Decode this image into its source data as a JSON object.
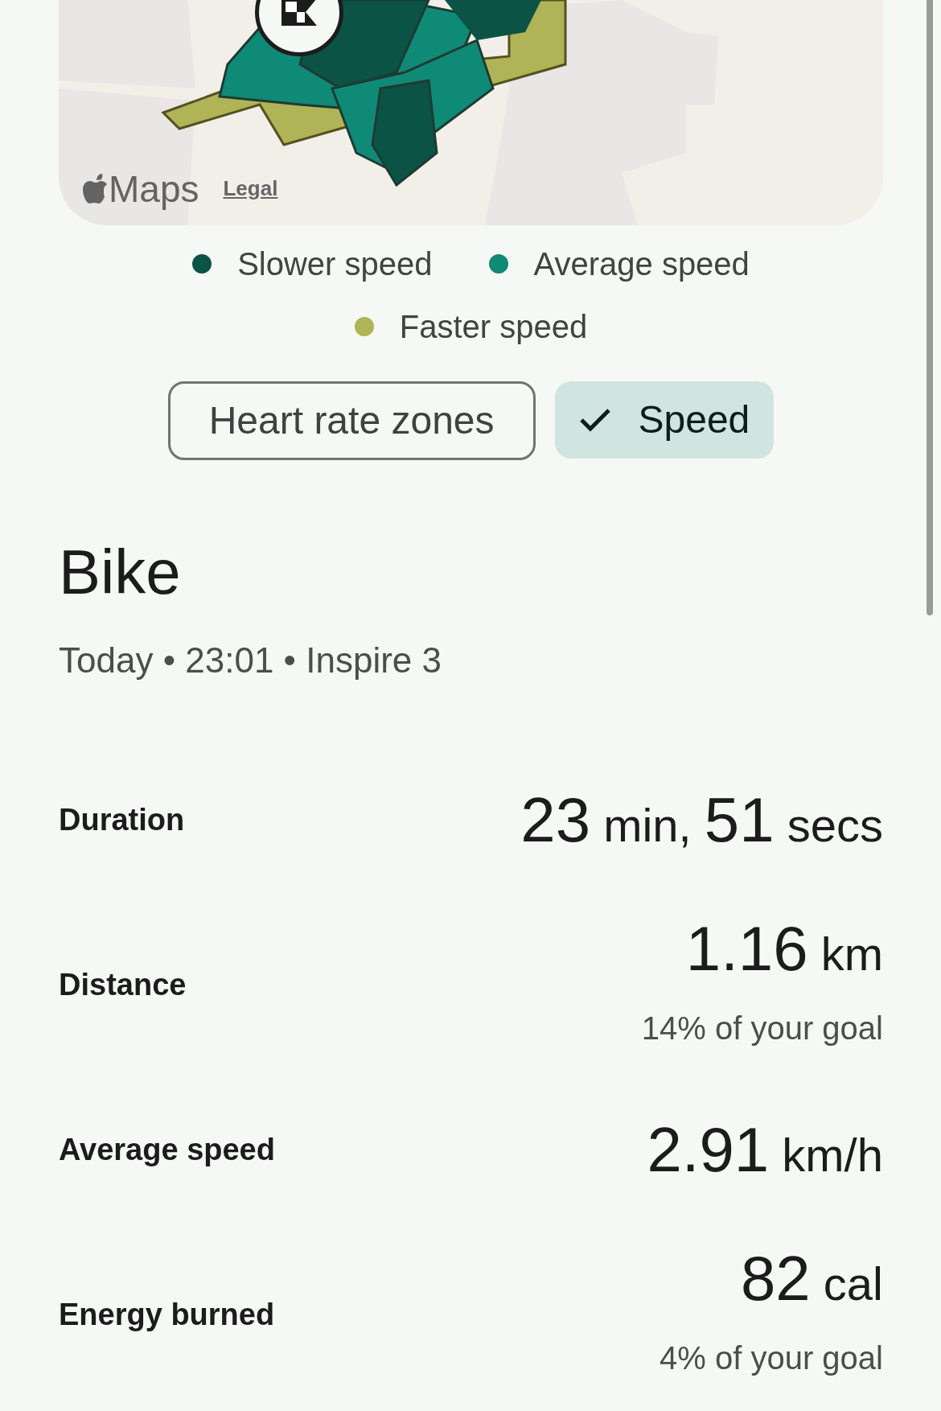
{
  "map": {
    "attribution": "Maps",
    "legal_link": "Legal"
  },
  "legend": [
    {
      "label": "Slower speed",
      "color": "#0b5345"
    },
    {
      "label": "Average speed",
      "color": "#0f8a77"
    },
    {
      "label": "Faster speed",
      "color": "#b0b456"
    }
  ],
  "chips": [
    {
      "label": "Heart rate zones",
      "selected": false
    },
    {
      "label": "Speed",
      "selected": true
    }
  ],
  "activity": {
    "title": "Bike",
    "meta": "Today • 23:01 • Inspire 3"
  },
  "stats": [
    {
      "label": "Duration",
      "value": [
        {
          "number": "23",
          "unit": "min,"
        },
        {
          "number": "51",
          "unit": "secs"
        }
      ]
    },
    {
      "label": "Distance",
      "value": [
        {
          "number": "1.16",
          "unit": "km"
        }
      ],
      "note": "14% of your goal"
    },
    {
      "label": "Average speed",
      "value": [
        {
          "number": "2.91",
          "unit": "km/h"
        }
      ]
    },
    {
      "label": "Energy burned",
      "value": [
        {
          "number": "82",
          "unit": "cal"
        }
      ],
      "note": "4% of your goal"
    }
  ]
}
